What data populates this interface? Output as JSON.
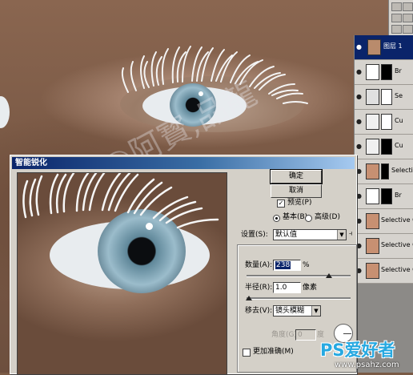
{
  "layers_panel": {
    "layers": [
      {
        "name": "图层 1",
        "selected": true
      },
      {
        "name": "Br",
        "selected": false
      },
      {
        "name": "Se",
        "selected": false
      },
      {
        "name": "Cu",
        "selected": false
      },
      {
        "name": "Cu",
        "selected": false
      },
      {
        "name": "Selecti",
        "selected": false
      },
      {
        "name": "Br",
        "selected": false
      },
      {
        "name": "Selective Co",
        "selected": false
      },
      {
        "name": "Selective Co",
        "selected": false
      },
      {
        "name": "Selective Co",
        "selected": false
      }
    ]
  },
  "dialog": {
    "title": "智能锐化",
    "ok_label": "确定",
    "cancel_label": "取消",
    "preview_label": "预览(P)",
    "preview_checked": true,
    "mode_basic_label": "基本(B)",
    "mode_advanced_label": "高级(D)",
    "settings_label": "设置(S):",
    "settings_value": "默认值",
    "amount_label": "数量(A):",
    "amount_value": "238",
    "amount_unit": "%",
    "amount_slider_fraction": 0.79,
    "radius_label": "半径(R):",
    "radius_value": "1.0",
    "radius_unit": "像素",
    "radius_slider_fraction": 0.02,
    "remove_label": "移去(V):",
    "remove_value": "镜头模糊",
    "angle_label": "角度(G):",
    "angle_value": "0",
    "angle_unit": "度",
    "more_accurate_label": "更加准确(M)",
    "more_accurate_checked": false
  },
  "watermark": {
    "text": "图片@阿寳,品龍",
    "site_logo": "PS爱好者",
    "site_url": "www.psahz.com"
  }
}
